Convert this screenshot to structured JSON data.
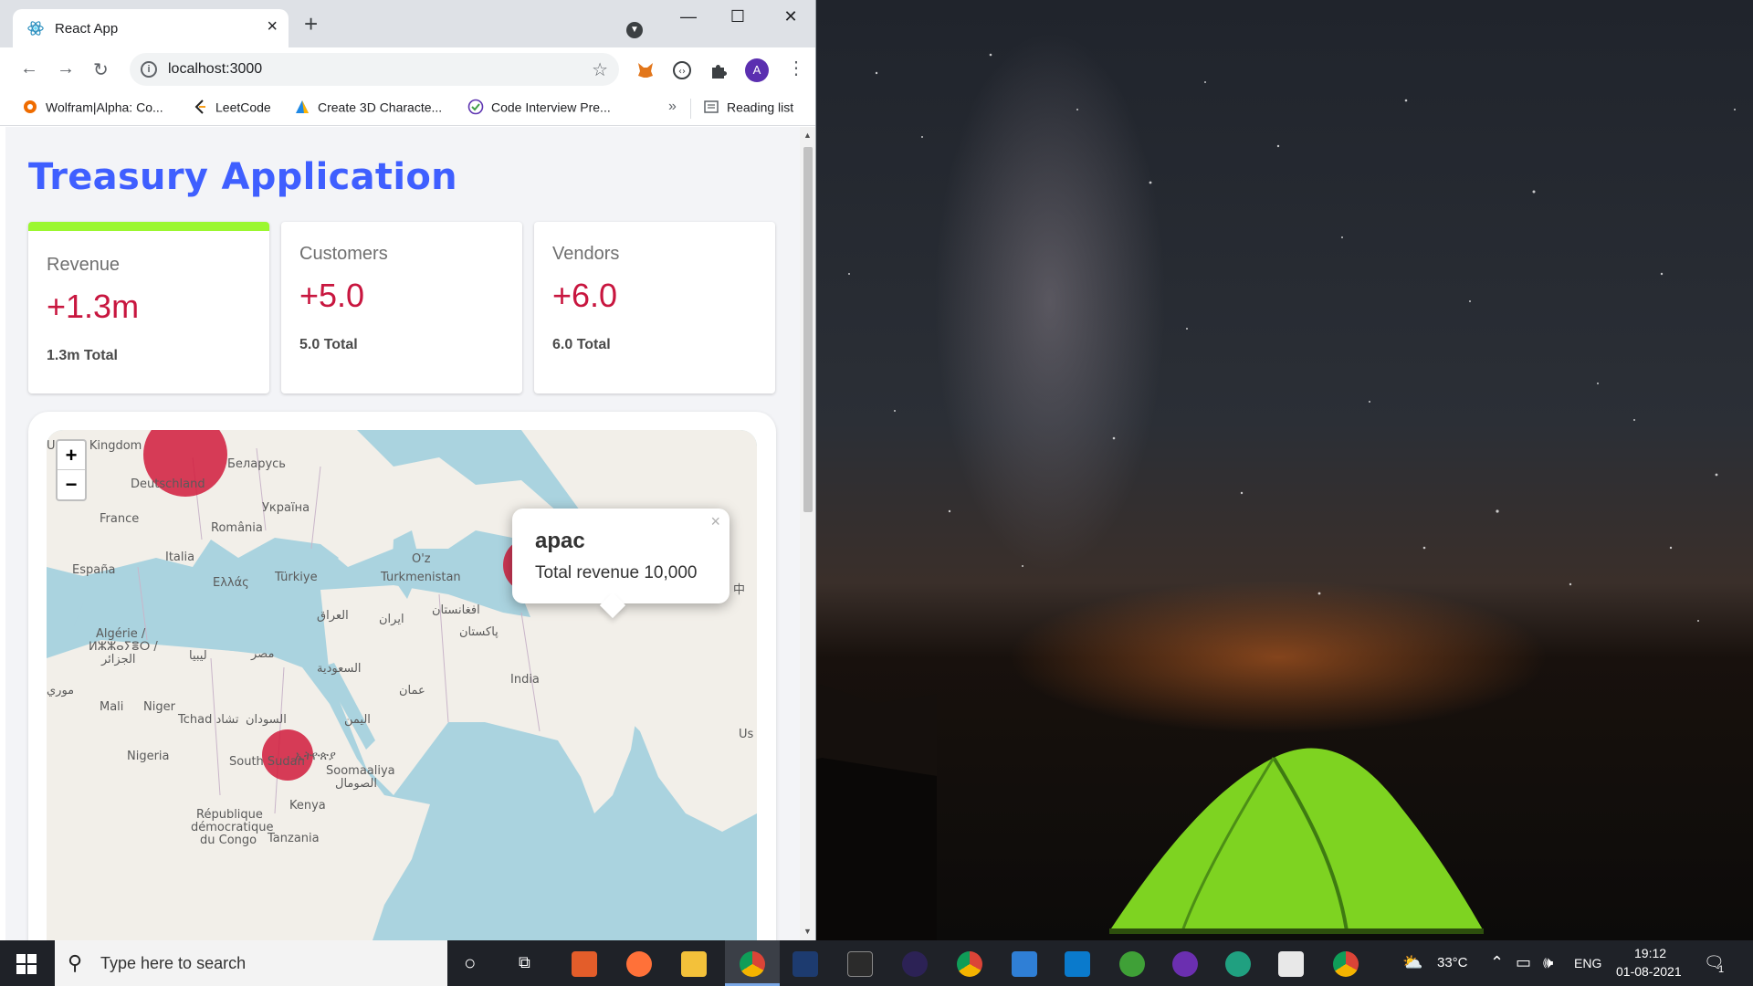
{
  "browser": {
    "tab_title": "React App",
    "url": "localhost:3000",
    "avatar_initial": "A",
    "bookmarks": [
      {
        "label": "Wolfram|Alpha: Co..."
      },
      {
        "label": "LeetCode"
      },
      {
        "label": "Create 3D Characte..."
      },
      {
        "label": "Code Interview Pre..."
      }
    ],
    "more_bookmarks": "»",
    "reading_list": "Reading list"
  },
  "app": {
    "title": "Treasury Application",
    "cards": [
      {
        "label": "Revenue",
        "value": "+1.3m",
        "total": "1.3m Total",
        "active": true
      },
      {
        "label": "Customers",
        "value": "+5.0",
        "total": "5.0 Total",
        "active": false
      },
      {
        "label": "Vendors",
        "value": "+6.0",
        "total": "6.0 Total",
        "active": false
      }
    ],
    "map": {
      "zoom_in": "+",
      "zoom_out": "−",
      "popup": {
        "title": "apac",
        "body": "Total revenue 10,000",
        "close": "×"
      },
      "labels": [
        "United Kingdom",
        "Беларусь",
        "Deutschland",
        "Україна",
        "France",
        "România",
        "Italia",
        "España",
        "Ελλάς",
        "Türkiye",
        "Turkmenistan",
        "O'z",
        "中",
        "العراق",
        "ایران",
        "افغانستان",
        "پاکستان",
        "Algérie /",
        "ⵍⵣⵣⴰⵢⴻⵔ /",
        "الجزائر",
        "ليبيا",
        "مصر",
        "السعودية",
        "عمان",
        "India",
        "Mali",
        "Niger",
        "Tchad تشاد",
        "السودان",
        "اليمن",
        "Nigeria",
        "South Sudan",
        "ኢትዮጵያ",
        "Soomaaliya",
        "الصومال",
        "Kenya",
        "République",
        "démocratique",
        "du Congo",
        "Tanzania",
        "موري",
        "Us"
      ]
    }
  },
  "taskbar": {
    "search_placeholder": "Type here to search",
    "weather": "33°C",
    "language": "ENG",
    "time": "19:12",
    "date": "01-08-2021",
    "notification_count": "1"
  },
  "colors": {
    "title": "#3f5fff",
    "value": "#c8163f",
    "accent": "#9bf72f",
    "bubble": "#d11b3c"
  }
}
